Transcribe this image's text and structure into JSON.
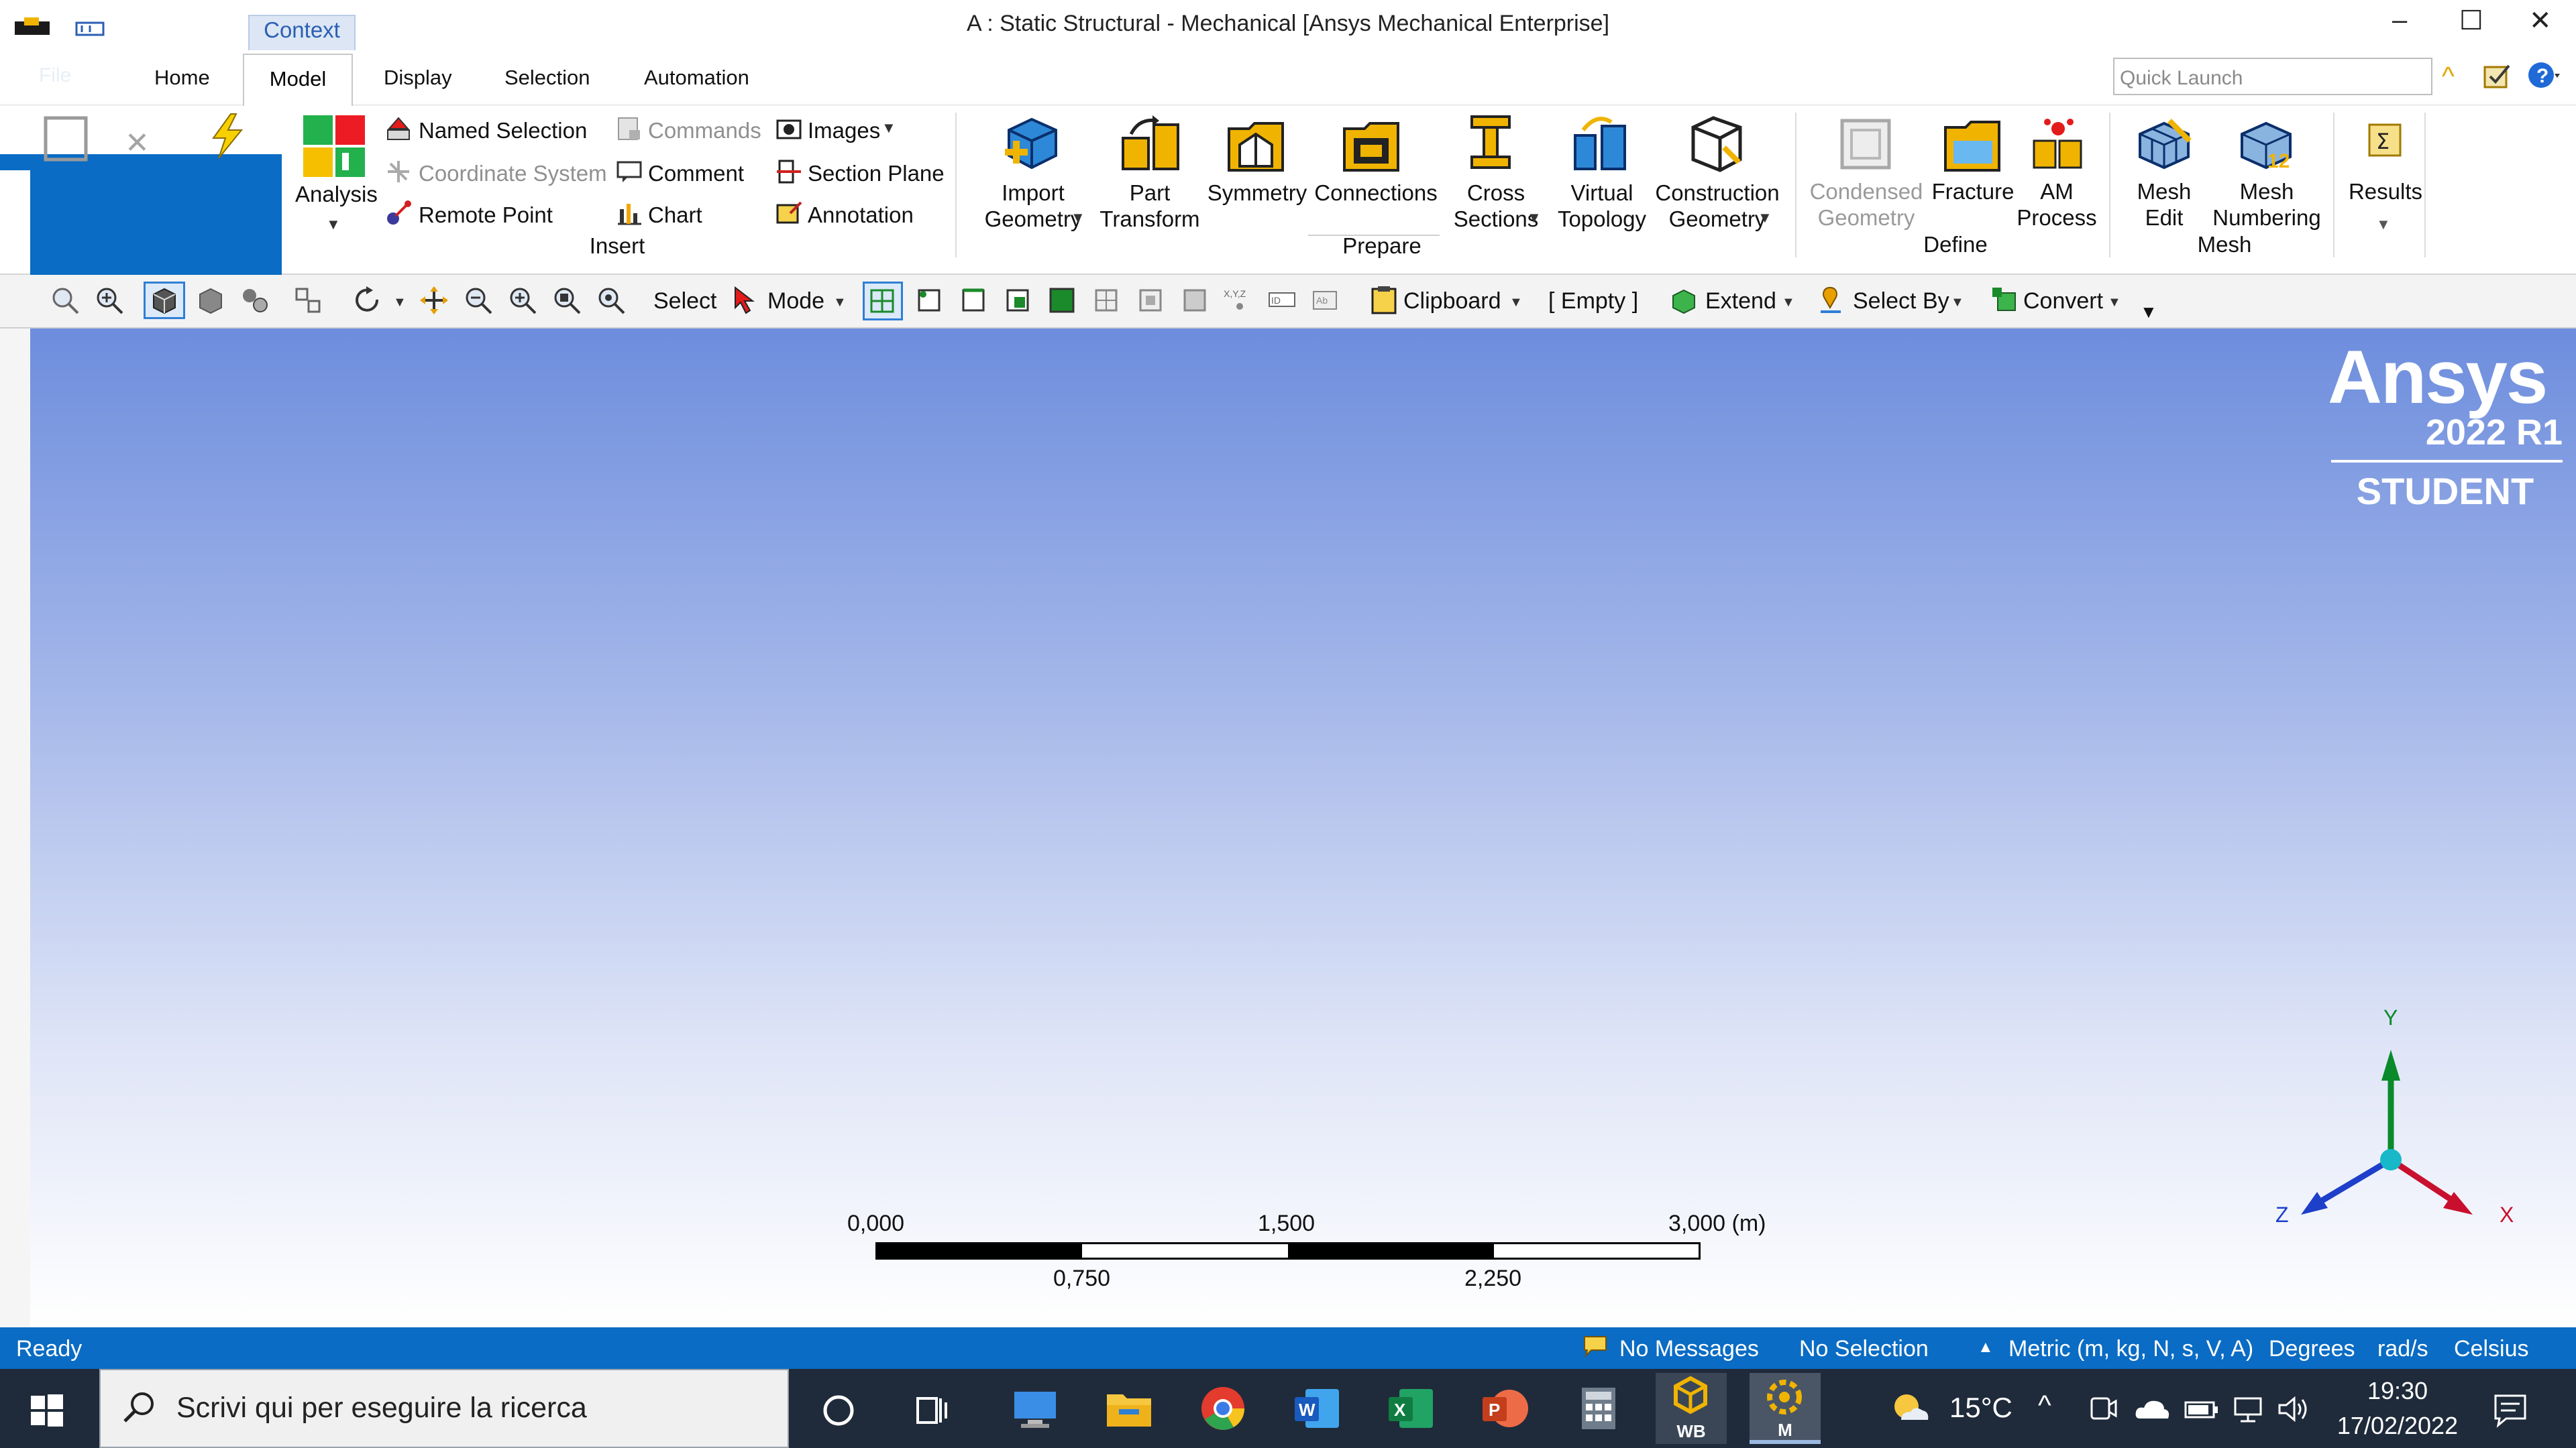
{
  "window": {
    "title": "A : Static Structural - Mechanical [Ansys Mechanical Enterprise]",
    "context_tab": "Context"
  },
  "tabs": {
    "file": "File",
    "home": "Home",
    "model": "Model",
    "display": "Display",
    "selection": "Selection",
    "automation": "Automation",
    "active": "Model"
  },
  "quick_launch": {
    "placeholder": "Quick Launch"
  },
  "ribbon": {
    "analysis": "Analysis",
    "insert": {
      "group": "Insert",
      "named_selection": "Named Selection",
      "coordinate_system": "Coordinate System",
      "remote_point": "Remote Point",
      "commands": "Commands",
      "comment": "Comment",
      "chart": "Chart",
      "images": "Images",
      "section_plane": "Section Plane",
      "annotation": "Annotation"
    },
    "prepare": {
      "group": "Prepare",
      "import_geometry": [
        "Import",
        "Geometry"
      ],
      "part_transform": [
        "Part",
        "Transform"
      ],
      "symmetry": "Symmetry",
      "connections": "Connections",
      "cross_sections": [
        "Cross",
        "Sections"
      ],
      "virtual_topology": [
        "Virtual",
        "Topology"
      ],
      "construction_geometry": [
        "Construction",
        "Geometry"
      ]
    },
    "define": {
      "group": "Define",
      "condensed_geometry": [
        "Condensed",
        "Geometry"
      ],
      "fracture": "Fracture",
      "am_process": [
        "AM",
        "Process"
      ]
    },
    "mesh": {
      "group": "Mesh",
      "mesh_edit": [
        "Mesh",
        "Edit"
      ],
      "mesh_numbering": [
        "Mesh",
        "Numbering"
      ]
    },
    "results": "Results"
  },
  "toolbar": {
    "select": "Select",
    "mode": "Mode",
    "clipboard": "Clipboard",
    "empty": "[ Empty ]",
    "extend": "Extend",
    "select_by": "Select By",
    "convert": "Convert"
  },
  "viewport": {
    "logo": "Ansys",
    "version": "2022 R1",
    "edition": "STUDENT",
    "scale": {
      "values": [
        "0,000",
        "1,500",
        "3,000 (m)"
      ],
      "sub_values": [
        "0,750",
        "2,250"
      ],
      "max_m": 3.0
    },
    "axes": {
      "x": "X",
      "y": "Y",
      "z": "Z"
    }
  },
  "status": {
    "ready": "Ready",
    "messages": "No Messages",
    "selection": "No Selection",
    "units": "Metric (m, kg, N, s, V, A)",
    "angle": "Degrees",
    "rate": "rad/s",
    "temp_unit": "Celsius"
  },
  "taskbar": {
    "search_placeholder": "Scrivi qui per eseguire la ricerca",
    "weather": "15°C",
    "time": "19:30",
    "date": "17/02/2022",
    "wb_label": "WB",
    "m_label": "M"
  },
  "colors": {
    "accent_blue": "#0a6cc4",
    "viewport_top": "#6d8ddd",
    "axis_x": "#c8102e",
    "axis_y": "#0a8a2a",
    "axis_z": "#1d3fc9"
  }
}
